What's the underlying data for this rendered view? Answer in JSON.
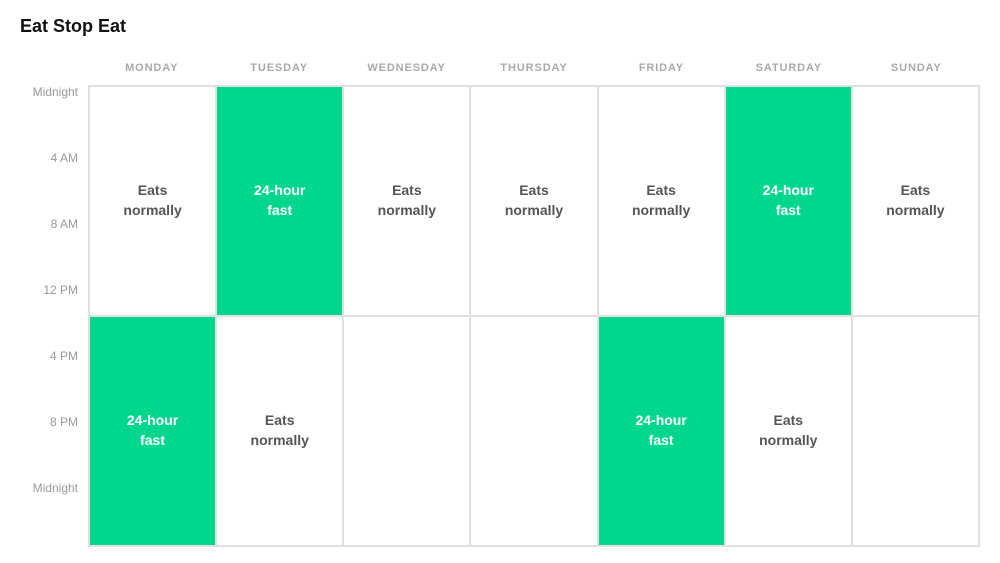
{
  "title": "Eat Stop Eat",
  "days": [
    "MONDAY",
    "TUESDAY",
    "WEDNESDAY",
    "THURSDAY",
    "FRIDAY",
    "SATURDAY",
    "SUNDAY"
  ],
  "timeLabels": [
    "Midnight",
    "4 AM",
    "8 AM",
    "12 PM",
    "4 PM",
    "8 PM",
    "Midnight"
  ],
  "cells": [
    [
      {
        "type": "white",
        "text": "Eats normally"
      },
      {
        "type": "green",
        "text": "24-hour fast"
      },
      {
        "type": "white",
        "text": "Eats normally"
      },
      {
        "type": "white",
        "text": "Eats normally"
      },
      {
        "type": "white",
        "text": "Eats normally"
      },
      {
        "type": "green",
        "text": "24-hour fast"
      },
      {
        "type": "white",
        "text": "Eats normally"
      }
    ],
    [
      {
        "type": "green",
        "text": "24-hour fast"
      },
      {
        "type": "white",
        "text": "Eats normally"
      },
      {
        "type": "white",
        "text": ""
      },
      {
        "type": "white",
        "text": ""
      },
      {
        "type": "green",
        "text": "24-hour fast"
      },
      {
        "type": "white",
        "text": "Eats normally"
      },
      {
        "type": "white",
        "text": ""
      }
    ]
  ],
  "labels": {
    "fast": "24-hour\nfast",
    "normal": "Eats\nnormally"
  }
}
